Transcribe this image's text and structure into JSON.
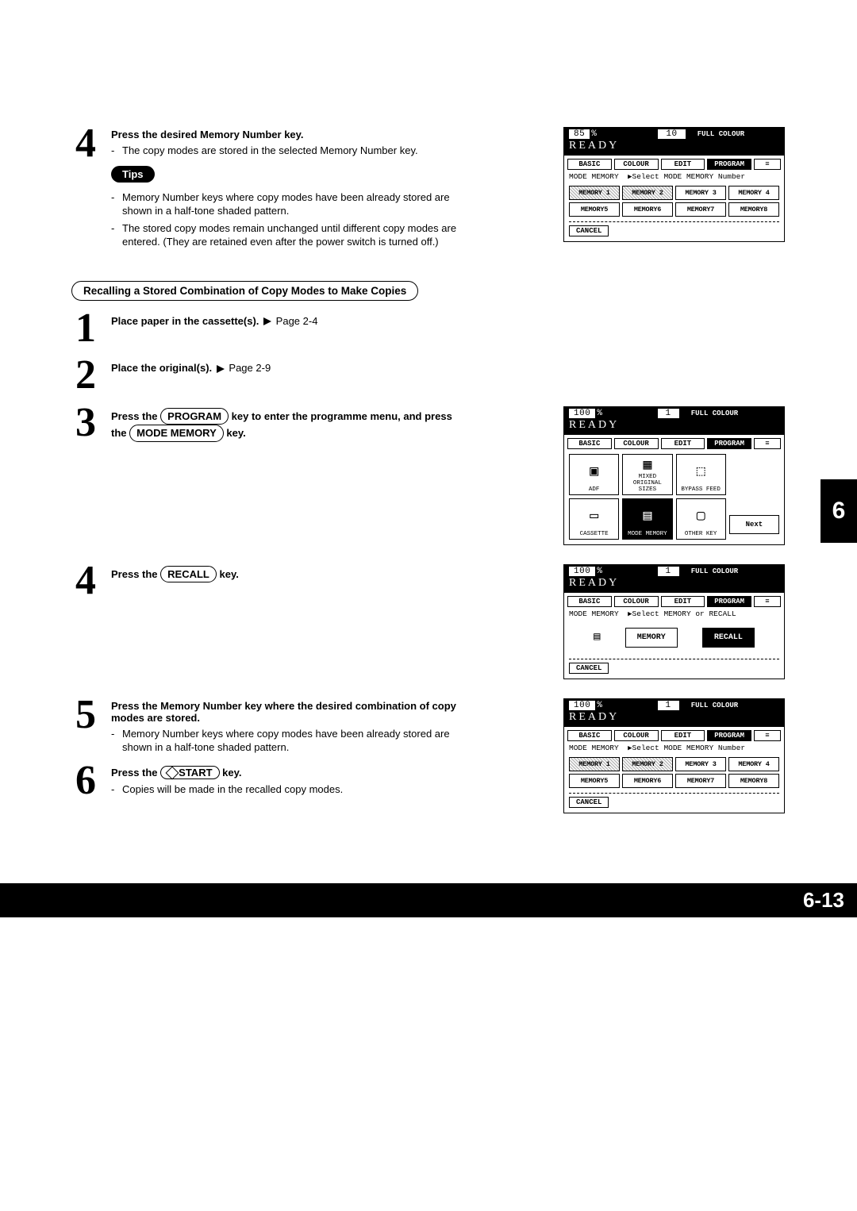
{
  "side_tab": "6",
  "page_number": "6-13",
  "step4a": {
    "title": "Press the desired Memory Number key.",
    "bullet1": "The copy modes are stored in the selected Memory Number key.",
    "tips_label": "Tips",
    "tip1": "Memory Number keys where copy modes have been already stored are shown in a half-tone shaded pattern.",
    "tip2": "The stored copy modes remain unchanged until different copy modes are entered. (They are retained even after the power switch is turned off.)"
  },
  "recall_heading": "Recalling a Stored Combination of Copy Modes to Make Copies",
  "step1": {
    "text": "Place paper in the cassette(s).",
    "ref": "Page 2-4"
  },
  "step2": {
    "text": "Place the original(s).",
    "ref": "Page 2-9"
  },
  "step3": {
    "pre": "Press the ",
    "key1": "PROGRAM",
    "mid": " key to enter the programme menu, and  press the ",
    "key2": "MODE MEMORY",
    "post": " key."
  },
  "step4b": {
    "pre": "Press the ",
    "key": "RECALL",
    "post": " key."
  },
  "step5": {
    "title": "Press the Memory Number key where the desired combination of copy modes are stored.",
    "bullet": "Memory Number keys where copy modes have been already stored are shown in a half-tone shaded pattern."
  },
  "step6": {
    "pre": "Press the ",
    "key": "START",
    "post": " key.",
    "bullet": "Copies will be made in the recalled copy modes."
  },
  "lcd1": {
    "zoom": "85",
    "zsym": "%",
    "count": "10",
    "fc": "FULL COLOUR",
    "ready": "READY",
    "tabs": [
      "BASIC",
      "COLOUR",
      "EDIT",
      "PROGRAM"
    ],
    "hint_label": "MODE MEMORY",
    "hint_text": "Select MODE MEMORY Number",
    "mem": [
      "MEMORY 1",
      "MEMORY 2",
      "MEMORY 3",
      "MEMORY 4",
      "MEMORY5",
      "MEMORY6",
      "MEMORY7",
      "MEMORY8"
    ],
    "cancel": "CANCEL"
  },
  "lcd2": {
    "zoom": "100",
    "zsym": "%",
    "count": "1",
    "fc": "FULL COLOUR",
    "ready": "READY",
    "tabs": [
      "BASIC",
      "COLOUR",
      "EDIT",
      "PROGRAM"
    ],
    "cells": [
      "ADF",
      "MIXED ORIGINAL SIZES",
      "BYPASS FEED",
      "",
      "CASSETTE",
      "MODE MEMORY",
      "OTHER KEY"
    ],
    "next": "Next"
  },
  "lcd3": {
    "zoom": "100",
    "zsym": "%",
    "count": "1",
    "fc": "FULL COLOUR",
    "ready": "READY",
    "tabs": [
      "BASIC",
      "COLOUR",
      "EDIT",
      "PROGRAM"
    ],
    "hint_label": "MODE MEMORY",
    "hint_text": "Select MEMORY or RECALL",
    "memory": "MEMORY",
    "recall": "RECALL",
    "cancel": "CANCEL"
  },
  "lcd4": {
    "zoom": "100",
    "zsym": "%",
    "count": "1",
    "fc": "FULL COLOUR",
    "ready": "READY",
    "tabs": [
      "BASIC",
      "COLOUR",
      "EDIT",
      "PROGRAM"
    ],
    "hint_label": "MODE MEMORY",
    "hint_text": "Select MODE MEMORY Number",
    "mem": [
      "MEMORY 1",
      "MEMORY 2",
      "MEMORY 3",
      "MEMORY 4",
      "MEMORY5",
      "MEMORY6",
      "MEMORY7",
      "MEMORY8"
    ],
    "cancel": "CANCEL"
  }
}
